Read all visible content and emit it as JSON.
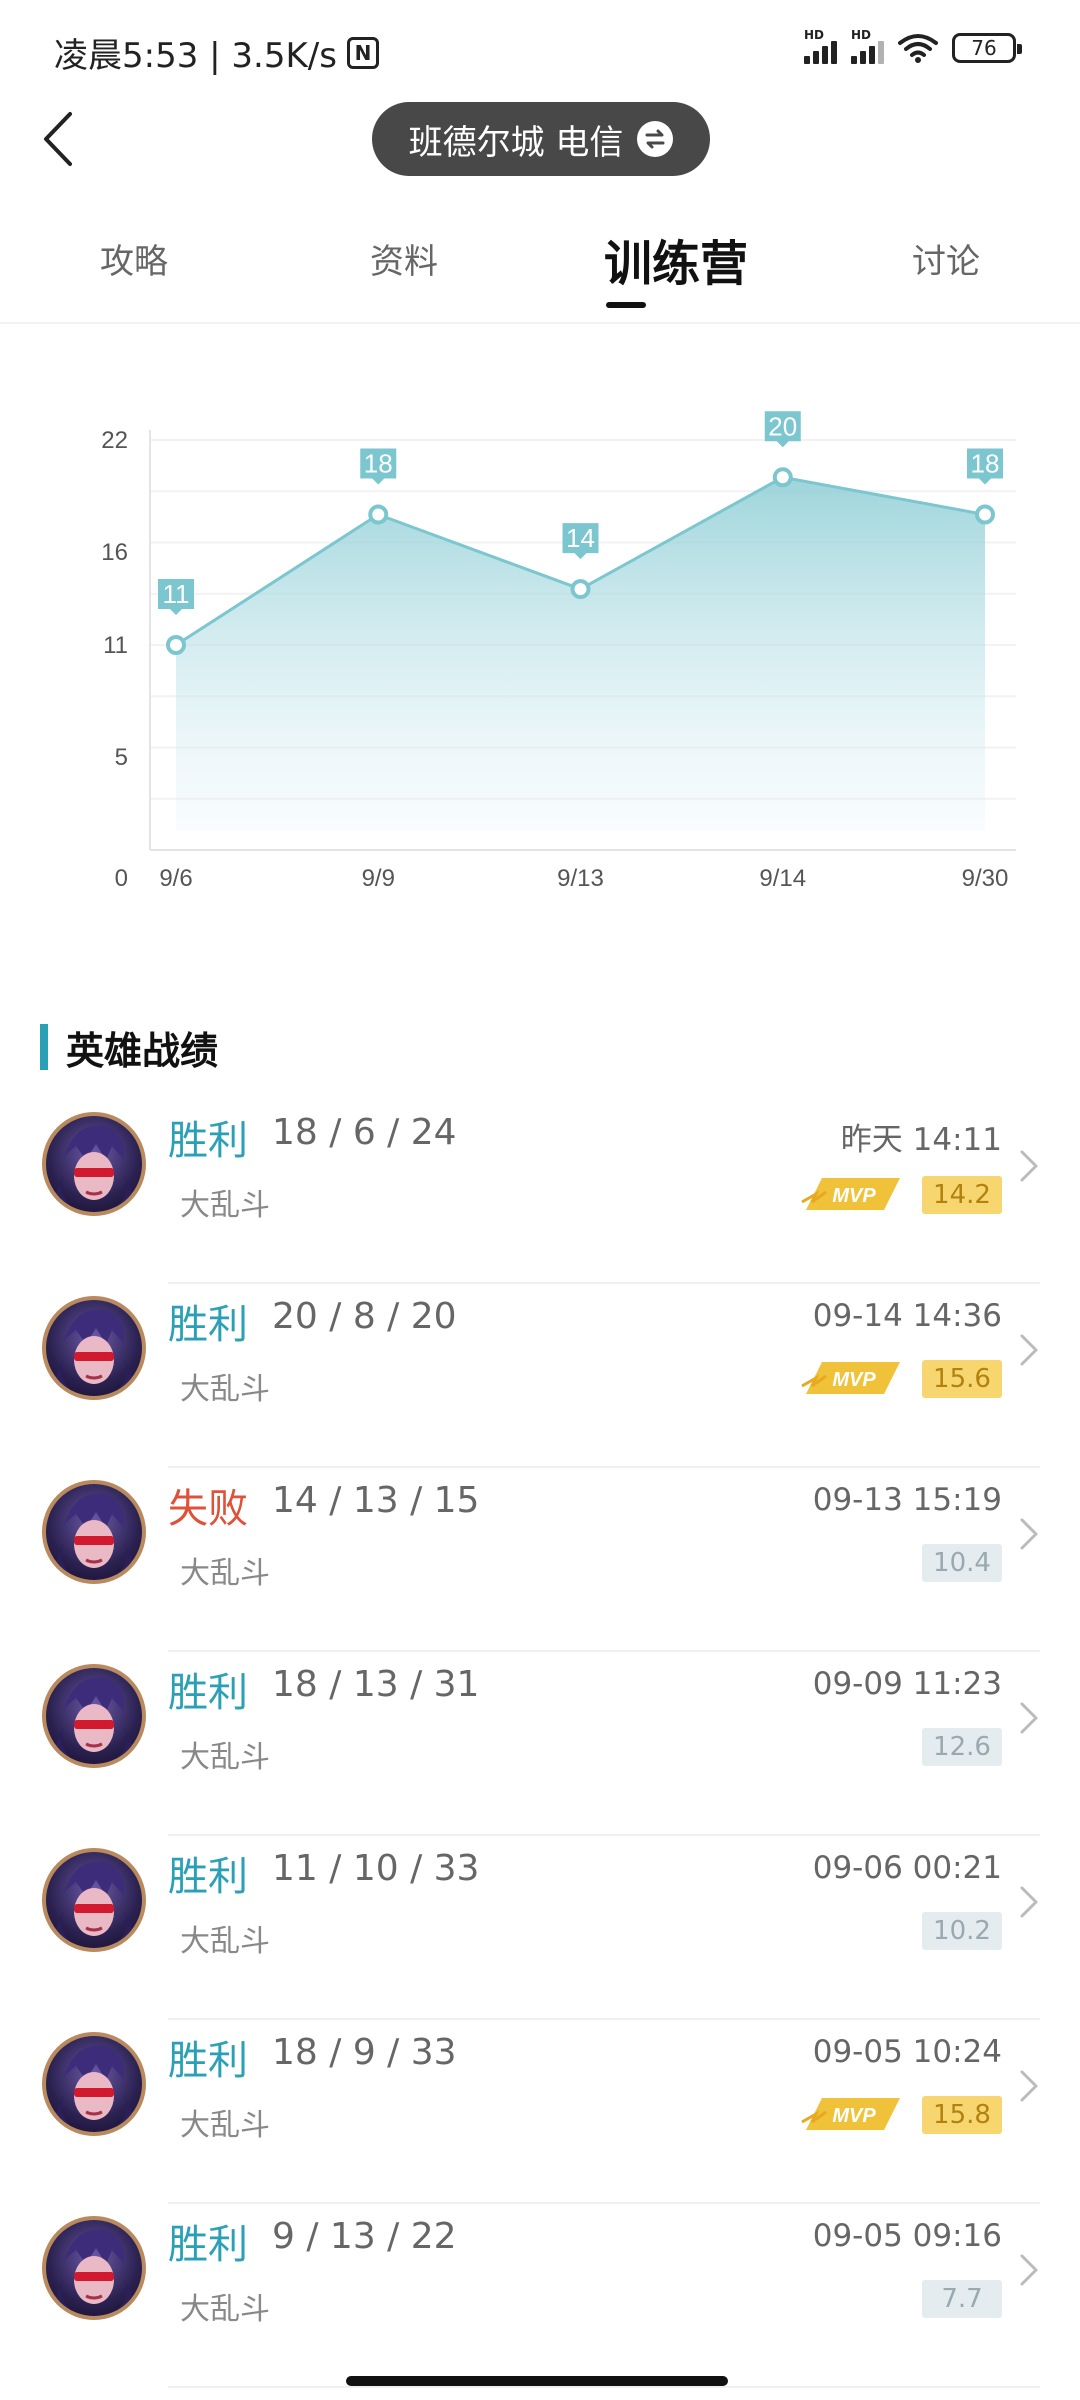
{
  "status": {
    "time": "凌晨5:53 | 3.5K/s",
    "nfc": "N",
    "battery": "76",
    "hd": "HD"
  },
  "header": {
    "back_icon": "back-arrow-icon",
    "server": "班德尔城 电信",
    "swap_icon": "swap-icon"
  },
  "tabs": [
    "攻略",
    "资料",
    "训练营",
    "讨论"
  ],
  "active_tab": 2,
  "chart_data": {
    "type": "area",
    "categories": [
      "9/6",
      "9/9",
      "9/13",
      "9/14",
      "9/30"
    ],
    "values": [
      11,
      18,
      14,
      20,
      18
    ],
    "y_ticks": [
      "0",
      "5",
      "11",
      "16",
      "22"
    ],
    "ylim": [
      0,
      22
    ],
    "grid": true,
    "color": "#7cc6cf"
  },
  "section_title": "英雄战绩",
  "matches": [
    {
      "result": "胜利",
      "outcome": "win",
      "kda": "18 / 6 / 24",
      "mode": "大乱斗",
      "time": "昨天 14:11",
      "score": "14.2",
      "mvp": true
    },
    {
      "result": "胜利",
      "outcome": "win",
      "kda": "20 / 8 / 20",
      "mode": "大乱斗",
      "time": "09-14 14:36",
      "score": "15.6",
      "mvp": true
    },
    {
      "result": "失败",
      "outcome": "lose",
      "kda": "14 / 13 / 15",
      "mode": "大乱斗",
      "time": "09-13 15:19",
      "score": "10.4",
      "mvp": false
    },
    {
      "result": "胜利",
      "outcome": "win",
      "kda": "18 / 13 / 31",
      "mode": "大乱斗",
      "time": "09-09 11:23",
      "score": "12.6",
      "mvp": false
    },
    {
      "result": "胜利",
      "outcome": "win",
      "kda": "11 / 10 / 33",
      "mode": "大乱斗",
      "time": "09-06 00:21",
      "score": "10.2",
      "mvp": false
    },
    {
      "result": "胜利",
      "outcome": "win",
      "kda": "18 / 9 / 33",
      "mode": "大乱斗",
      "time": "09-05 10:24",
      "score": "15.8",
      "mvp": true
    },
    {
      "result": "胜利",
      "outcome": "win",
      "kda": "9 / 13 / 22",
      "mode": "大乱斗",
      "time": "09-05 09:16",
      "score": "7.7",
      "mvp": false
    }
  ],
  "mvp_label": "MVP",
  "colors": {
    "accent": "#2aa0b6",
    "lose": "#e0513a",
    "mvp": "#f7d56f"
  }
}
